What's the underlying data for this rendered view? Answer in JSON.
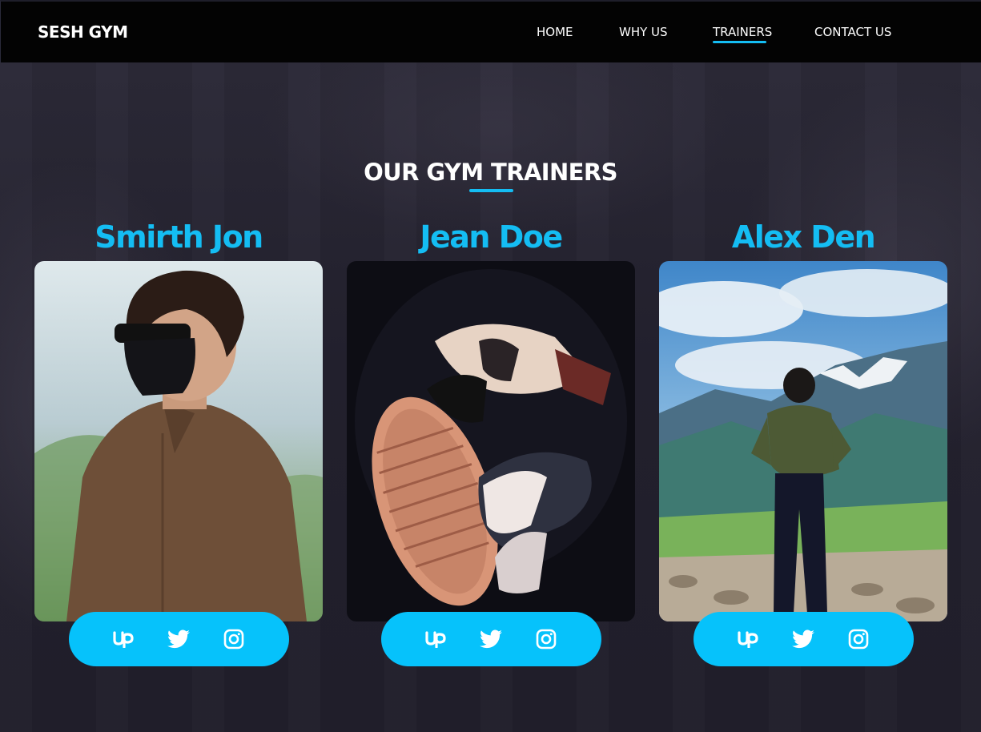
{
  "brand": "SESH GYM",
  "nav": {
    "home": "HOME",
    "why_us": "WHY US",
    "trainers": "TRAINERS",
    "contact_us": "CONTACT US",
    "active": "trainers"
  },
  "section_title": "OUR GYM TRAINERS",
  "trainers": [
    {
      "name": "Smirth Jon",
      "social": [
        "upwork-icon",
        "twitter-icon",
        "instagram-icon"
      ]
    },
    {
      "name": "Jean Doe",
      "social": [
        "upwork-icon",
        "twitter-icon",
        "instagram-icon"
      ]
    },
    {
      "name": "Alex Den",
      "social": [
        "upwork-icon",
        "twitter-icon",
        "instagram-icon"
      ]
    }
  ],
  "colors": {
    "accent": "#14bdf3",
    "social_bar": "#06c2fb",
    "navbar": "#030303",
    "background": "#23212e"
  }
}
